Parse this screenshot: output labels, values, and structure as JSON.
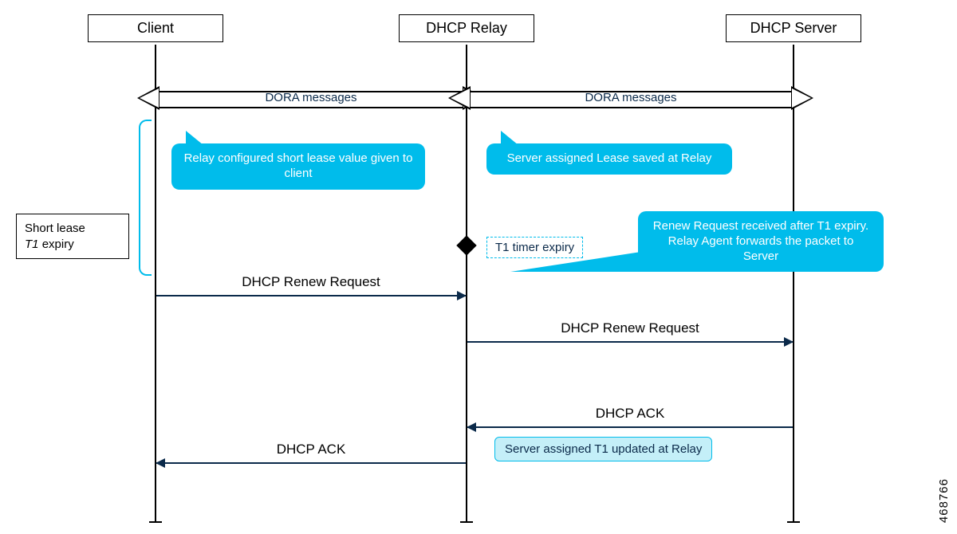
{
  "actors": {
    "client": "Client",
    "relay": "DHCP Relay",
    "server": "DHCP Server"
  },
  "dora": {
    "left": "DORA messages",
    "right": "DORA messages"
  },
  "callouts": {
    "short_lease": "Relay configured short lease value given to client",
    "lease_saved": "Server assigned Lease saved at Relay",
    "renew_forward": "Renew Request received after T1 expiry. Relay Agent forwards the packet to Server"
  },
  "sidebox": {
    "l1": "Short lease",
    "l2": "T1",
    "l3": " expiry"
  },
  "events": {
    "t1_expiry": "T1 timer expiry"
  },
  "messages": {
    "renew1": "DHCP Renew Request",
    "renew2": "DHCP Renew Request",
    "ack1": "DHCP ACK",
    "ack2": "DHCP ACK"
  },
  "notes": {
    "t1_updated": "Server assigned T1 updated at Relay"
  },
  "image_id": "468766"
}
